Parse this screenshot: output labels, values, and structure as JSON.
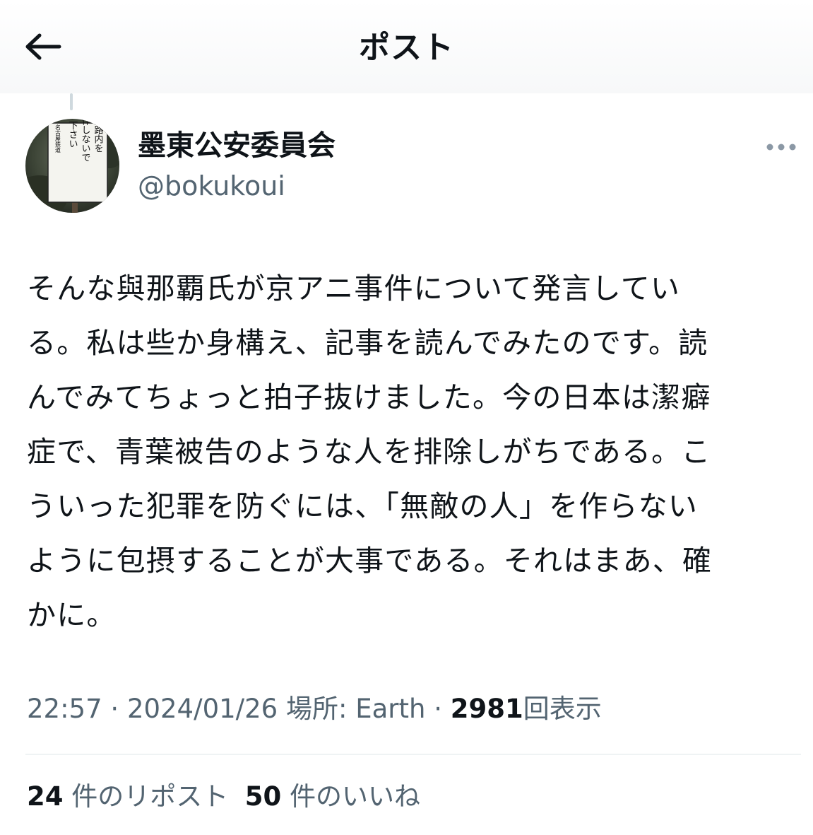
{
  "header": {
    "title": "ポスト",
    "back_icon": "arrow-left-icon"
  },
  "author": {
    "name": "墨東公安委員会",
    "handle": "@bokukoui",
    "avatar_sign_text": [
      "線路内を",
      "耕作しないで",
      "下さい"
    ],
    "avatar_sign_footer": "名古屋鉄道",
    "more_icon": "more-horizontal-icon"
  },
  "tweet": {
    "lines": [
      "そんな與那覇氏が京アニ事件について発言してい",
      "る。私は些か身構え、記事を読んでみたのです。読",
      "んでみてちょっと拍子抜けました。今の日本は潔癖",
      "症で、青葉被告のような人を排除しがちである。こ",
      "ういった犯罪を防ぐには、「無敵の人」を作らない",
      "ように包摂することが大事である。それはまあ、確",
      "かに。"
    ]
  },
  "meta": {
    "time": "22:57",
    "separator": "·",
    "date": "2024/01/26",
    "location_label": "場所: Earth",
    "views_count": "2981",
    "views_label": "回表示"
  },
  "stats": {
    "reposts_count": "24",
    "reposts_label": "件のリポスト",
    "likes_count": "50",
    "likes_label": "件のいいね"
  },
  "colors": {
    "text_primary": "#0f1419",
    "text_secondary": "#536471",
    "divider": "#eff3f4"
  }
}
